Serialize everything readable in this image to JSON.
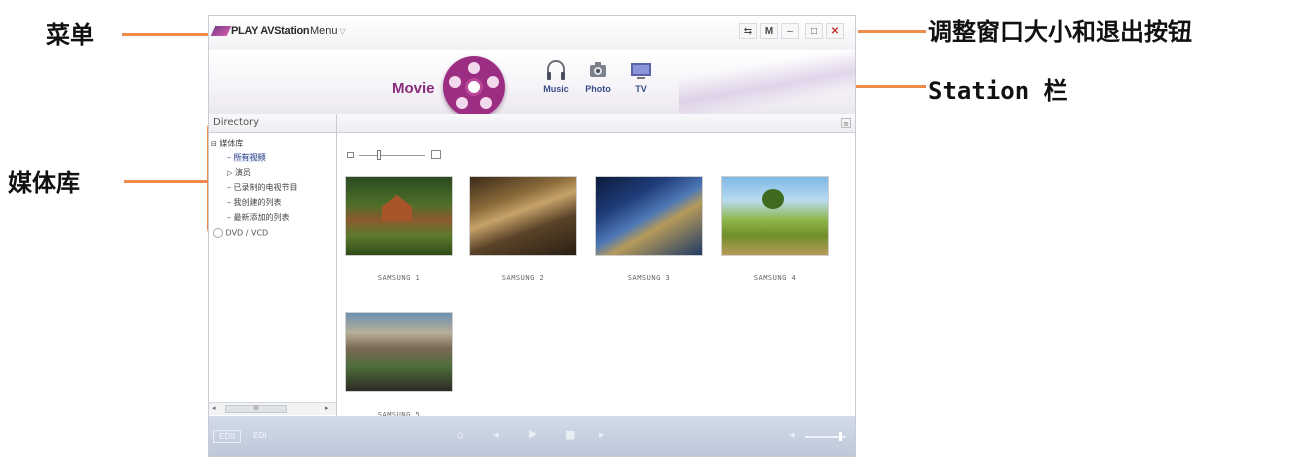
{
  "annotations": {
    "menu": "菜单",
    "window_buttons": "调整窗口大小和退出按钮",
    "station_bar": "Station 栏",
    "media_library": "媒体库"
  },
  "app": {
    "title": "PLAY AVStation",
    "menu_label": "Menu",
    "window_buttons": [
      "⇆",
      "M",
      "–",
      "□",
      "✕"
    ]
  },
  "station": {
    "current": "Movie",
    "items": [
      {
        "label": "Music",
        "icon": "headphones-icon"
      },
      {
        "label": "Photo",
        "icon": "camera-icon"
      },
      {
        "label": "TV",
        "icon": "tv-icon"
      }
    ]
  },
  "sidebar": {
    "header": "Directory",
    "tree": [
      {
        "label": "媒体库",
        "level": 0
      },
      {
        "label": "所有视频",
        "level": 1,
        "selected": true
      },
      {
        "label": "演员",
        "level": 1
      },
      {
        "label": "已录制的电视节目",
        "level": 1
      },
      {
        "label": "我创建的列表",
        "level": 1
      },
      {
        "label": "最新添加的列表",
        "level": 1
      },
      {
        "label": "DVD / VCD",
        "level": 0
      }
    ],
    "scroll_label": "III"
  },
  "content": {
    "items": [
      {
        "label": "SAMSUNG 1"
      },
      {
        "label": "SAMSUNG 2"
      },
      {
        "label": "SAMSUNG 3"
      },
      {
        "label": "SAMSUNG 4"
      },
      {
        "label": "SAMSUNG 5"
      }
    ]
  },
  "bottombar": {
    "tab1": "EDS",
    "tab2": "EDI"
  },
  "colors": {
    "accent": "#f08a4b",
    "movie": "#8a2a7b",
    "station_text": "#3b4e8a"
  }
}
